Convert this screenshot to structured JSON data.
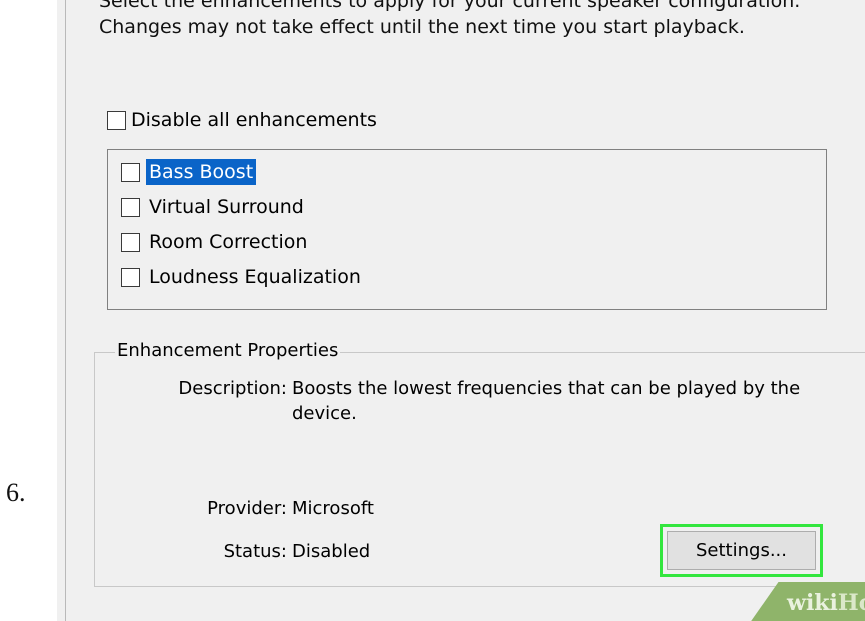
{
  "step_number": "6.",
  "intro_text": "Select the enhancements to apply for your current speaker configuration. Changes may not take effect until the next time you start playback.",
  "disable_all": {
    "label": "Disable all enhancements",
    "checked": false
  },
  "enhancements": [
    {
      "label": "Bass Boost",
      "checked": false,
      "selected": true
    },
    {
      "label": "Virtual Surround",
      "checked": false,
      "selected": false
    },
    {
      "label": "Room Correction",
      "checked": false,
      "selected": false
    },
    {
      "label": "Loudness Equalization",
      "checked": false,
      "selected": false
    }
  ],
  "properties": {
    "title": "Enhancement Properties",
    "description_label": "Description:",
    "description_value": "Boosts the lowest frequencies that can be played by the device.",
    "provider_label": "Provider:",
    "provider_value": "Microsoft",
    "status_label": "Status:",
    "status_value": "Disabled"
  },
  "settings_button": "Settings...",
  "watermark": {
    "part1": "wiki",
    "part2": "How"
  },
  "colors": {
    "highlight_border": "#33e63e",
    "selection": "#0a64c8",
    "dialog_bg": "#f0f0f0"
  }
}
